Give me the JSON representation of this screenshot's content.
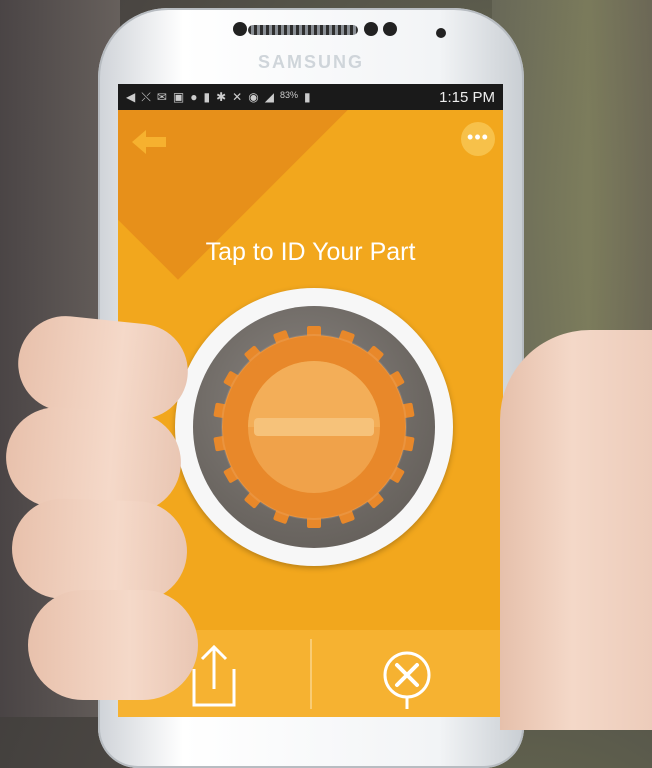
{
  "device": {
    "brand": "SAMSUNG"
  },
  "status_bar": {
    "battery": "83%",
    "time": "1:15 PM",
    "icons": [
      "back-icon",
      "signal-icon",
      "mail-icon",
      "calendar-icon",
      "chat-icon",
      "lock-icon",
      "bluetooth-icon",
      "mute-icon",
      "wifi-icon",
      "cell-signal-icon",
      "battery-icon"
    ]
  },
  "header": {
    "back_icon": "arrow-left-icon",
    "more_icon": "more-dots-icon",
    "more_label": "•••"
  },
  "main": {
    "title": "Tap to ID Your Part",
    "gear_button_icon": "gear-scan-icon",
    "side_tab_icon": "chevron-right-icon",
    "side_tab_label": "›"
  },
  "bottom_bar": {
    "left_icon": "share-icon",
    "right_icon": "wrench-screwdriver-icon"
  },
  "colors": {
    "primary": "#f2a71d",
    "dark_accent": "#e7901a",
    "light_accent": "#f8cf6b",
    "text": "#ffffff"
  }
}
